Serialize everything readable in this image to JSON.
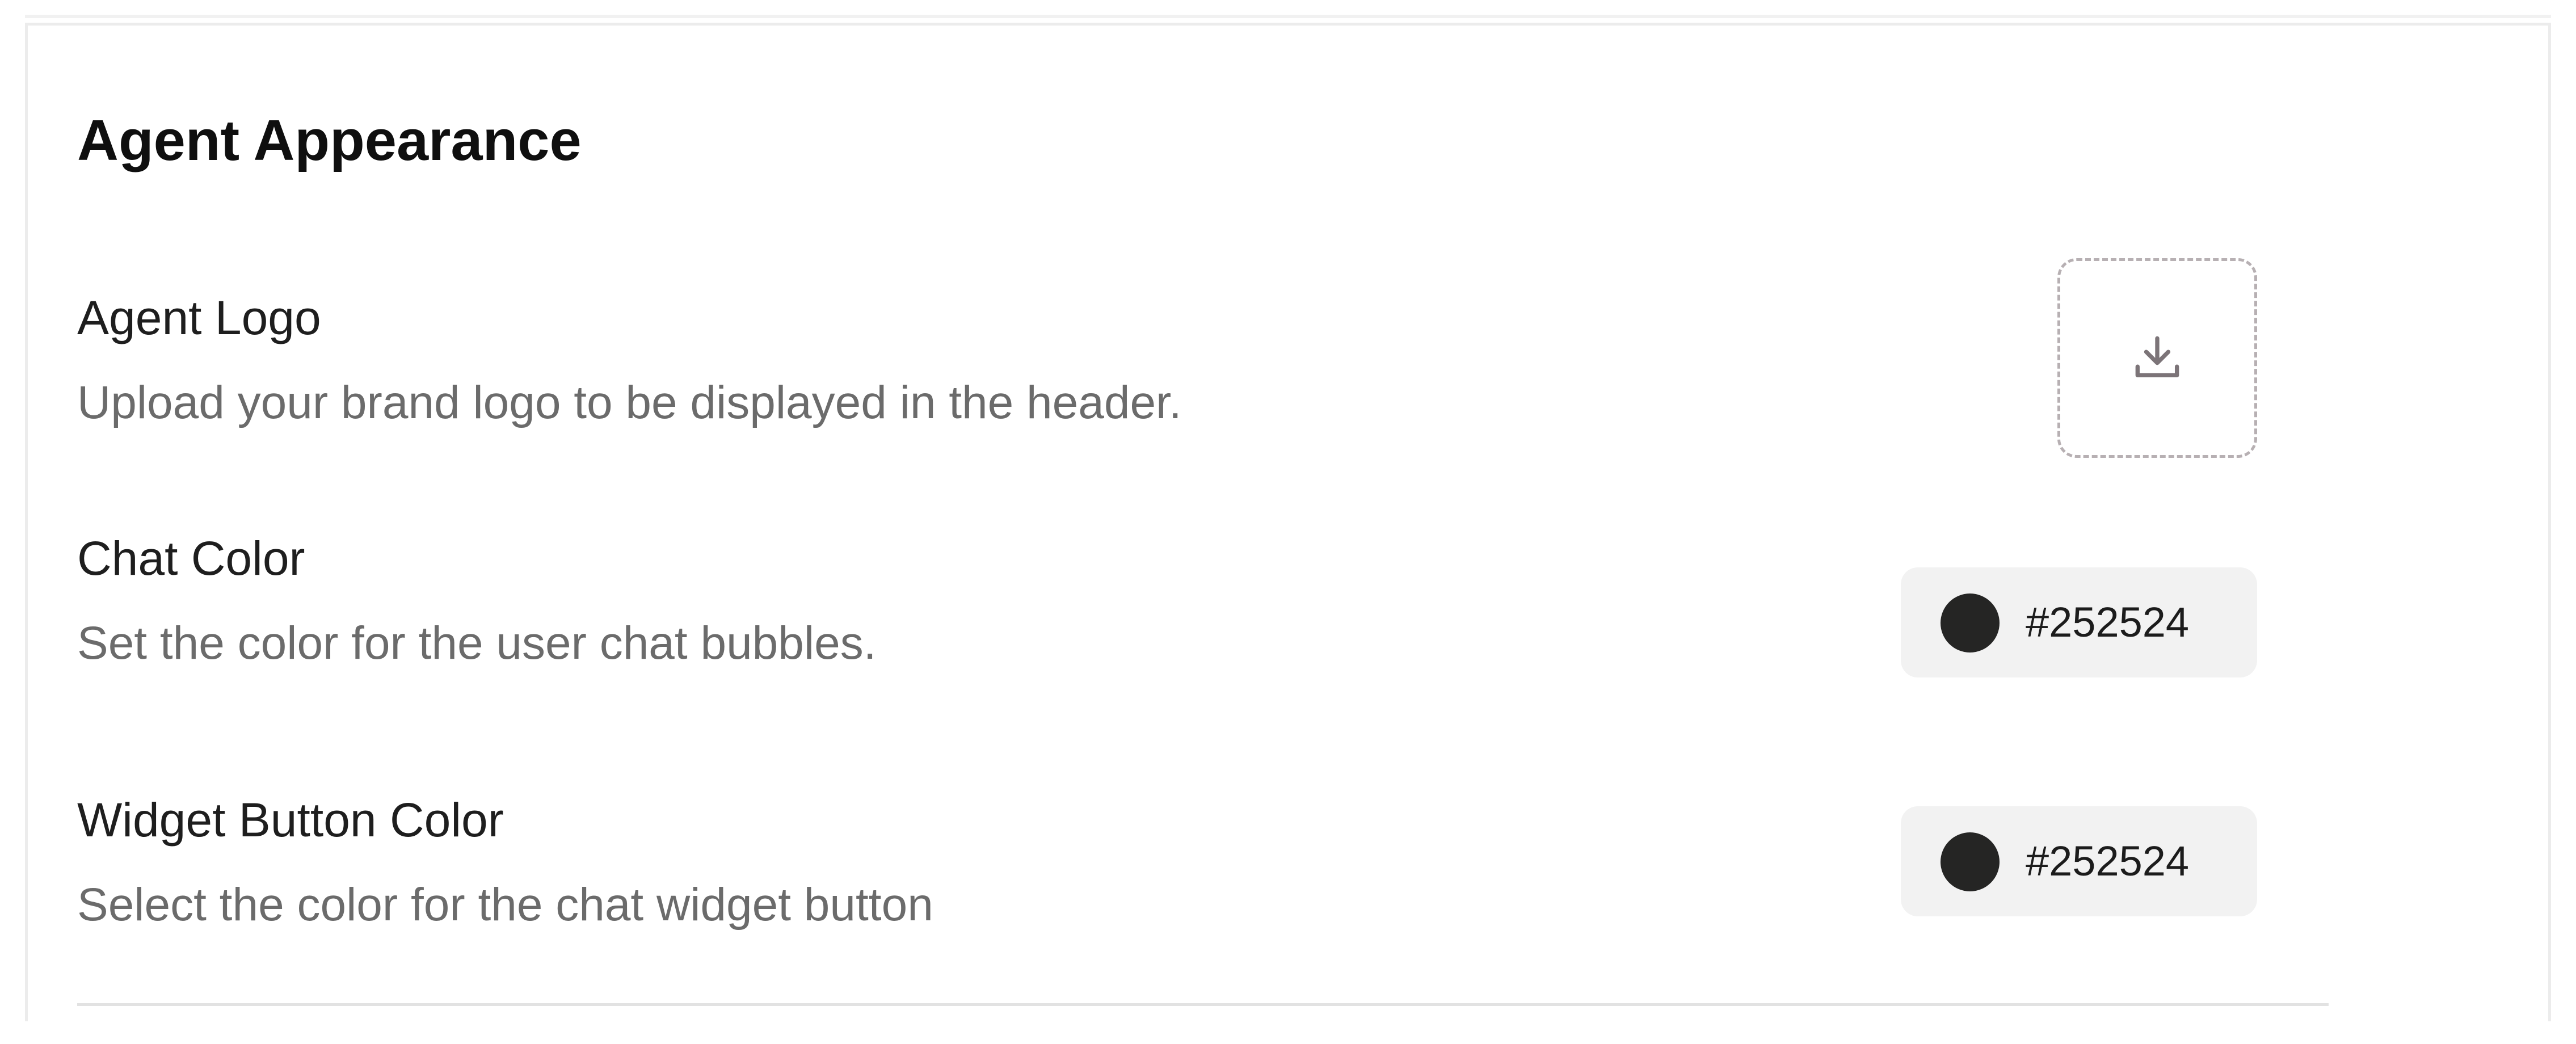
{
  "section": {
    "title": "Agent Appearance"
  },
  "agent_logo": {
    "title": "Agent Logo",
    "description": "Upload your brand logo to be displayed in the header.",
    "upload_icon": "download-tray-icon"
  },
  "chat_color": {
    "title": "Chat Color",
    "description": "Set the color for the user chat bubbles.",
    "value": "#252524",
    "swatch_color": "#252524"
  },
  "widget_button_color": {
    "title": "Widget Button Color",
    "description": "Select the color for the chat widget button",
    "value": "#252524",
    "swatch_color": "#252524"
  },
  "colors": {
    "card_border": "#ececec",
    "pill_background": "#f2f2f2",
    "dashed_border": "#b7b0b3",
    "description_text": "#6b6b6b"
  }
}
